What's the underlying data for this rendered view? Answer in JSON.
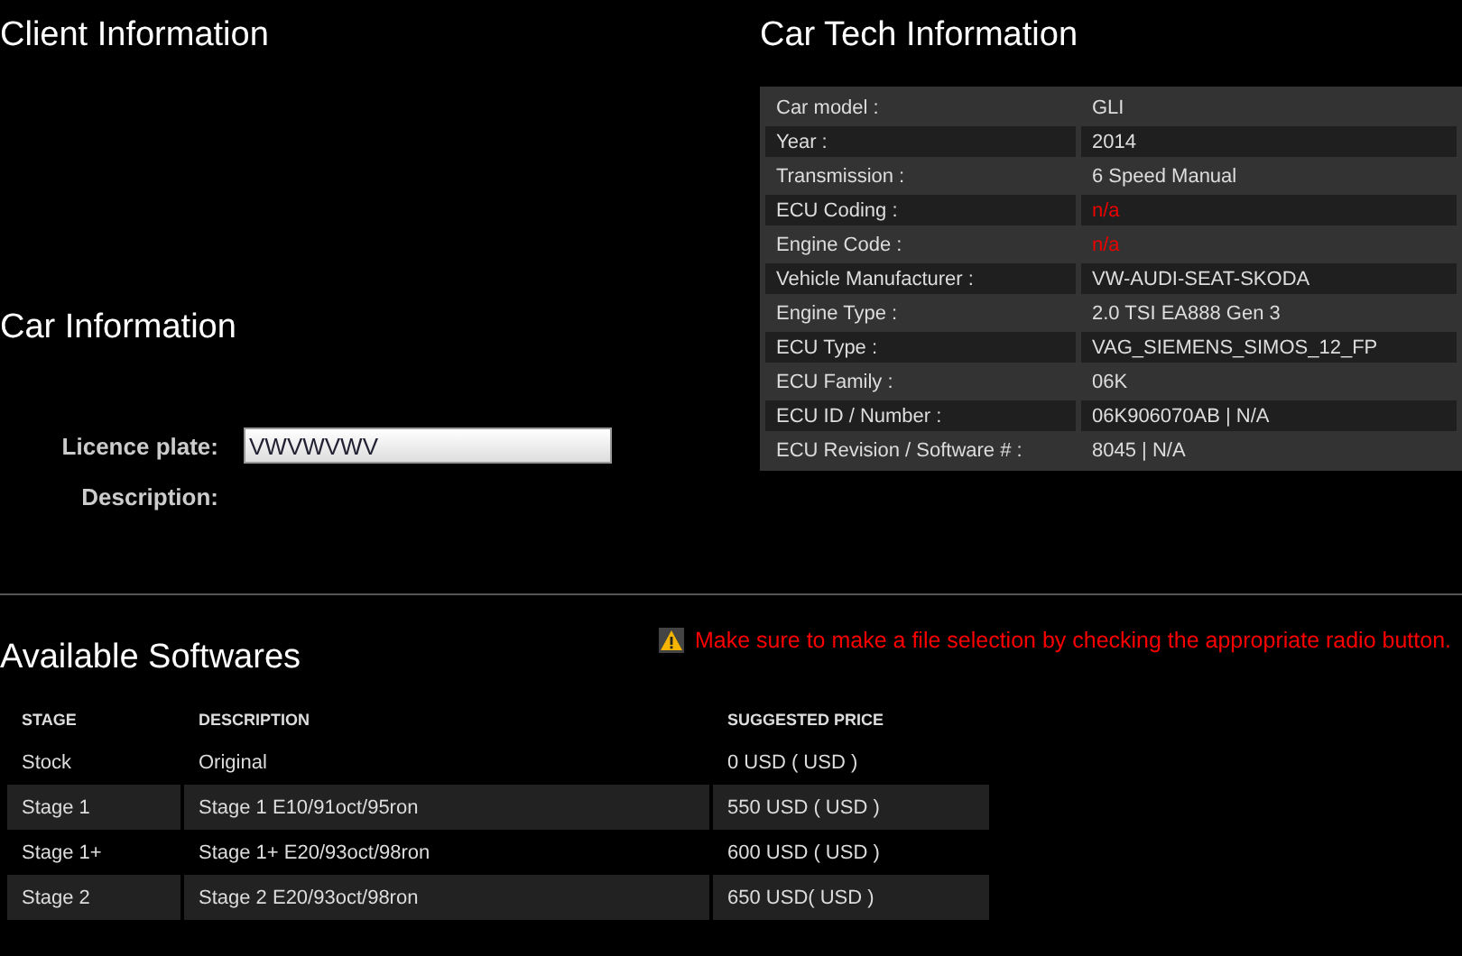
{
  "client_section": {
    "title": "Client Information"
  },
  "car_section": {
    "title": "Car Information",
    "fields": [
      {
        "label": "Licence plate:",
        "kind": "input",
        "value": "VWVWVWV"
      },
      {
        "label": "Description:",
        "kind": "text"
      }
    ]
  },
  "tech_section": {
    "title": "Car Tech Information",
    "rows": [
      {
        "label": "Car model :",
        "value": "GLI",
        "kind": "normal"
      },
      {
        "label": "Year :",
        "value": "2014",
        "kind": "normal"
      },
      {
        "label": "Transmission :",
        "value": "6 Speed Manual",
        "kind": "normal"
      },
      {
        "label": "ECU Coding :",
        "value": "n/a",
        "kind": "missing"
      },
      {
        "label": "Engine Code :",
        "value": "n/a",
        "kind": "missing"
      },
      {
        "label": "Vehicle Manufacturer :",
        "value": "VW-AUDI-SEAT-SKODA",
        "kind": "normal"
      },
      {
        "label": "Engine Type :",
        "value": "2.0 TSI EA888 Gen 3",
        "kind": "normal"
      },
      {
        "label": "ECU Type :",
        "value": "VAG_SIEMENS_SIMOS_12_FP",
        "kind": "normal"
      },
      {
        "label": "ECU Family :",
        "value": "06K",
        "kind": "normal"
      },
      {
        "label": "ECU ID / Number :",
        "value": "06K906070AB | N/A",
        "kind": "normal"
      },
      {
        "label": "ECU Revision / Software # :",
        "value": "8045 | N/A",
        "kind": "normal"
      }
    ]
  },
  "software_section": {
    "title": "Available Softwares",
    "warning": "Make sure to make a file selection by checking the appropriate radio button.",
    "columns": [
      "STAGE",
      "DESCRIPTION",
      "SUGGESTED PRICE"
    ],
    "rows": [
      {
        "stage": "Stock",
        "description": "Original",
        "price": "0 USD ( USD )"
      },
      {
        "stage": "Stage 1",
        "description": "Stage 1 E10/91oct/95ron",
        "price": "550 USD ( USD )"
      },
      {
        "stage": "Stage 1+",
        "description": "Stage 1+ E20/93oct/98ron",
        "price": "600 USD ( USD )"
      },
      {
        "stage": "Stage 2",
        "description": "Stage 2 E20/93oct/98ron",
        "price": "650 USD( USD )"
      }
    ]
  }
}
